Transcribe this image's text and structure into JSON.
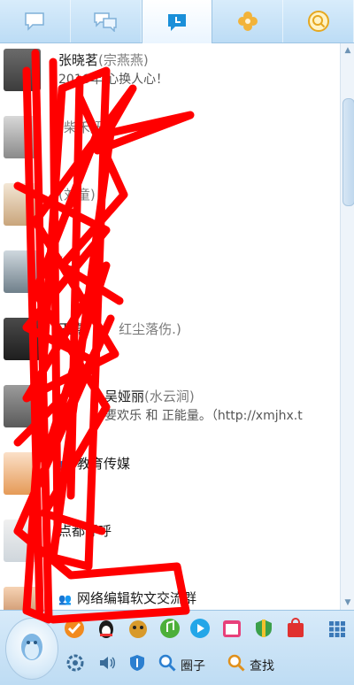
{
  "tabs": [
    {
      "name": "contacts",
      "icon": "chat-bubble-icon"
    },
    {
      "name": "groups",
      "icon": "group-chat-icon"
    },
    {
      "name": "recent",
      "icon": "recent-chat-icon"
    },
    {
      "name": "apps",
      "icon": "clover-icon"
    },
    {
      "name": "search",
      "icon": "search-circle-icon"
    }
  ],
  "contacts": [
    {
      "name": "",
      "remark": "",
      "signature": "",
      "partial_name": "张晓茗",
      "partial_remark": "(宗燕燕)",
      "partial_sig": "2016年 心换人心！"
    },
    {
      "name": "",
      "remark": "(柴禾妞)",
      "signature": ""
    },
    {
      "name": "",
      "remark": "(刘童)",
      "signature": ""
    },
    {
      "name": "",
      "remark": "(云)",
      "signature": ""
    },
    {
      "name": "王嘉",
      "remark": "红尘落伤.)",
      "signature": ""
    },
    {
      "name": "吴娅丽",
      "remark": "(水云涧)",
      "signature": "要欢乐 和 正能量。（http://xmjhx.t"
    },
    {
      "name": "教育传媒",
      "remark": "",
      "signature": "",
      "group": true
    },
    {
      "name": "点都呼呼",
      "remark": "",
      "signature": ""
    },
    {
      "name": "网络编辑软文交流群",
      "remark": "",
      "signature": "",
      "group": true
    }
  ],
  "toolbar": {
    "qzone_label": "圈子",
    "find_label": "查找"
  },
  "colors": {
    "accent": "#1a8fd9",
    "scribble": "#ff0000"
  }
}
